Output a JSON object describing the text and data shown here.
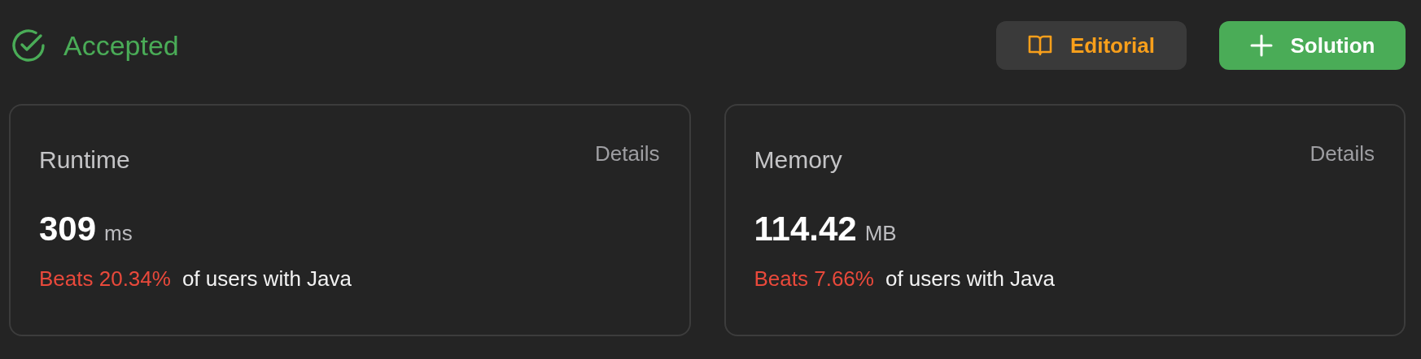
{
  "status": {
    "label": "Accepted"
  },
  "buttons": [
    {
      "kind": "editorial",
      "label": "Editorial"
    },
    {
      "kind": "solution",
      "label": "Solution"
    }
  ],
  "cards": [
    {
      "title": "Runtime",
      "link": "Details",
      "value": "309",
      "unit": "ms",
      "beats": "Beats 20.34%",
      "note": "of users with Java"
    },
    {
      "title": "Memory",
      "link": "Details",
      "value": "114.42",
      "unit": "MB",
      "beats": "Beats 7.66%",
      "note": "of users with Java"
    }
  ]
}
